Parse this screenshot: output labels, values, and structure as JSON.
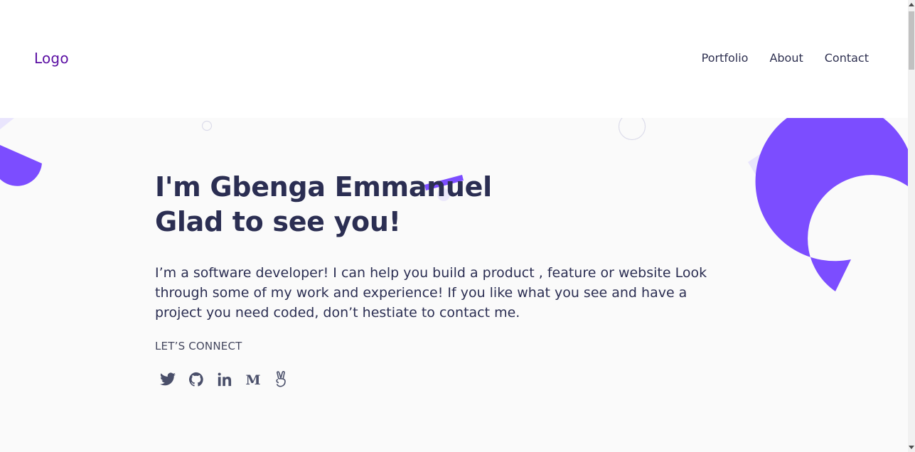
{
  "header": {
    "logo": "Logo",
    "nav": [
      {
        "label": "Portfolio"
      },
      {
        "label": "About"
      },
      {
        "label": "Contact"
      }
    ]
  },
  "hero": {
    "title_line1": "I'm Gbenga Emmanuel",
    "title_line2": "Glad to see you!",
    "intro": "I’m a software developer! I can help you build a product , feature or website Look through some of my work and experience! If you like what you see and have a project you need coded, don’t hestiate to contact me.",
    "connect_label": "LET’S CONNECT",
    "socials": [
      {
        "icon": "twitter-icon"
      },
      {
        "icon": "github-icon"
      },
      {
        "icon": "linkedin-icon"
      },
      {
        "icon": "medium-icon"
      },
      {
        "icon": "angellist-icon"
      }
    ]
  },
  "colors": {
    "accent": "#7c4dff",
    "accent_light": "#e9e5fd",
    "logo": "#5b0fa3",
    "text": "#2b2e52",
    "hero_bg": "#fafafa"
  }
}
